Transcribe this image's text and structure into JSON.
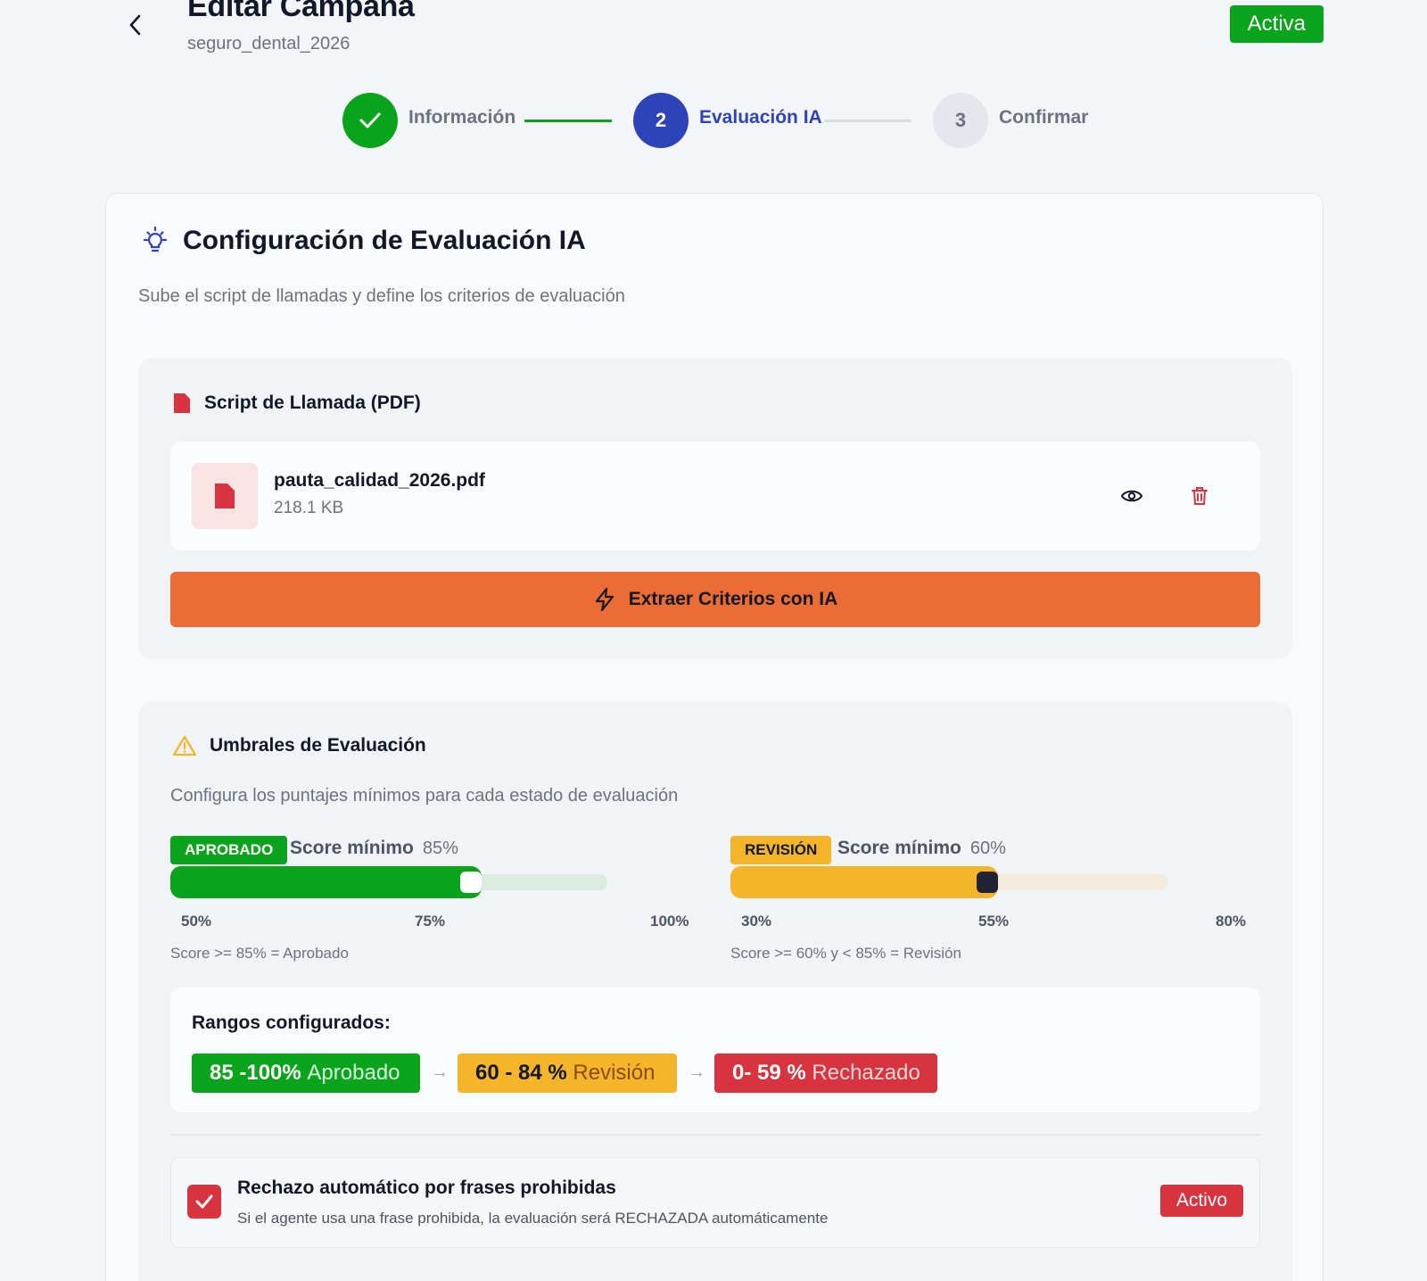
{
  "header": {
    "title": "Editar Campaña",
    "subtitle": "seguro_dental_2026",
    "status": "Activa"
  },
  "stepper": {
    "steps": [
      {
        "number": "1",
        "label": "Información",
        "state": "done"
      },
      {
        "number": "2",
        "label": "Evaluación IA",
        "state": "active"
      },
      {
        "number": "3",
        "label": "Confirmar",
        "state": "pending"
      }
    ]
  },
  "config": {
    "title": "Configuración de Evaluación IA",
    "description": "Sube el script de llamadas y define los criterios de evaluación"
  },
  "script": {
    "title": "Script de Llamada (PDF)",
    "file_name": "pauta_calidad_2026.pdf",
    "file_size": "218.1 KB",
    "extract_label": "Extraer Criterios con IA"
  },
  "thresholds": {
    "title": "Umbrales de Evaluación",
    "description": "Configura los puntajes mínimos para cada estado de evaluación",
    "approved": {
      "badge": "APROBADO",
      "label": "Score mínimo",
      "value": "85%",
      "min": 50,
      "max": 100,
      "current": 85,
      "ticks": [
        "50%",
        "75%",
        "100%"
      ],
      "rule": "Score >= 85% = Aprobado",
      "color": "#0aa31c"
    },
    "review": {
      "badge": "REVISIÓN",
      "label": "Score mínimo",
      "value": "60%",
      "min": 30,
      "max": 80,
      "current": 60,
      "ticks": [
        "30%",
        "55%",
        "80%"
      ],
      "rule": "Score >= 60% y < 85% = Revisión",
      "color": "#f6b42b"
    }
  },
  "ranges": {
    "title": "Rangos configurados:",
    "items": [
      {
        "range": "85 -100%",
        "label": "Aprobado",
        "color": "#0aa31c"
      },
      {
        "range": "60 - 84 %",
        "label": "Revisión",
        "color": "#f6b42b"
      },
      {
        "range": "0- 59 %",
        "label": "Rechazado",
        "color": "#d7343f"
      }
    ]
  },
  "auto_reject": {
    "title": "Rechazo automático por frases prohibidas",
    "description": "Si el agente usa una frase prohibida, la evaluación será RECHAZADA automáticamente",
    "checked": true,
    "badge": "Activo"
  }
}
